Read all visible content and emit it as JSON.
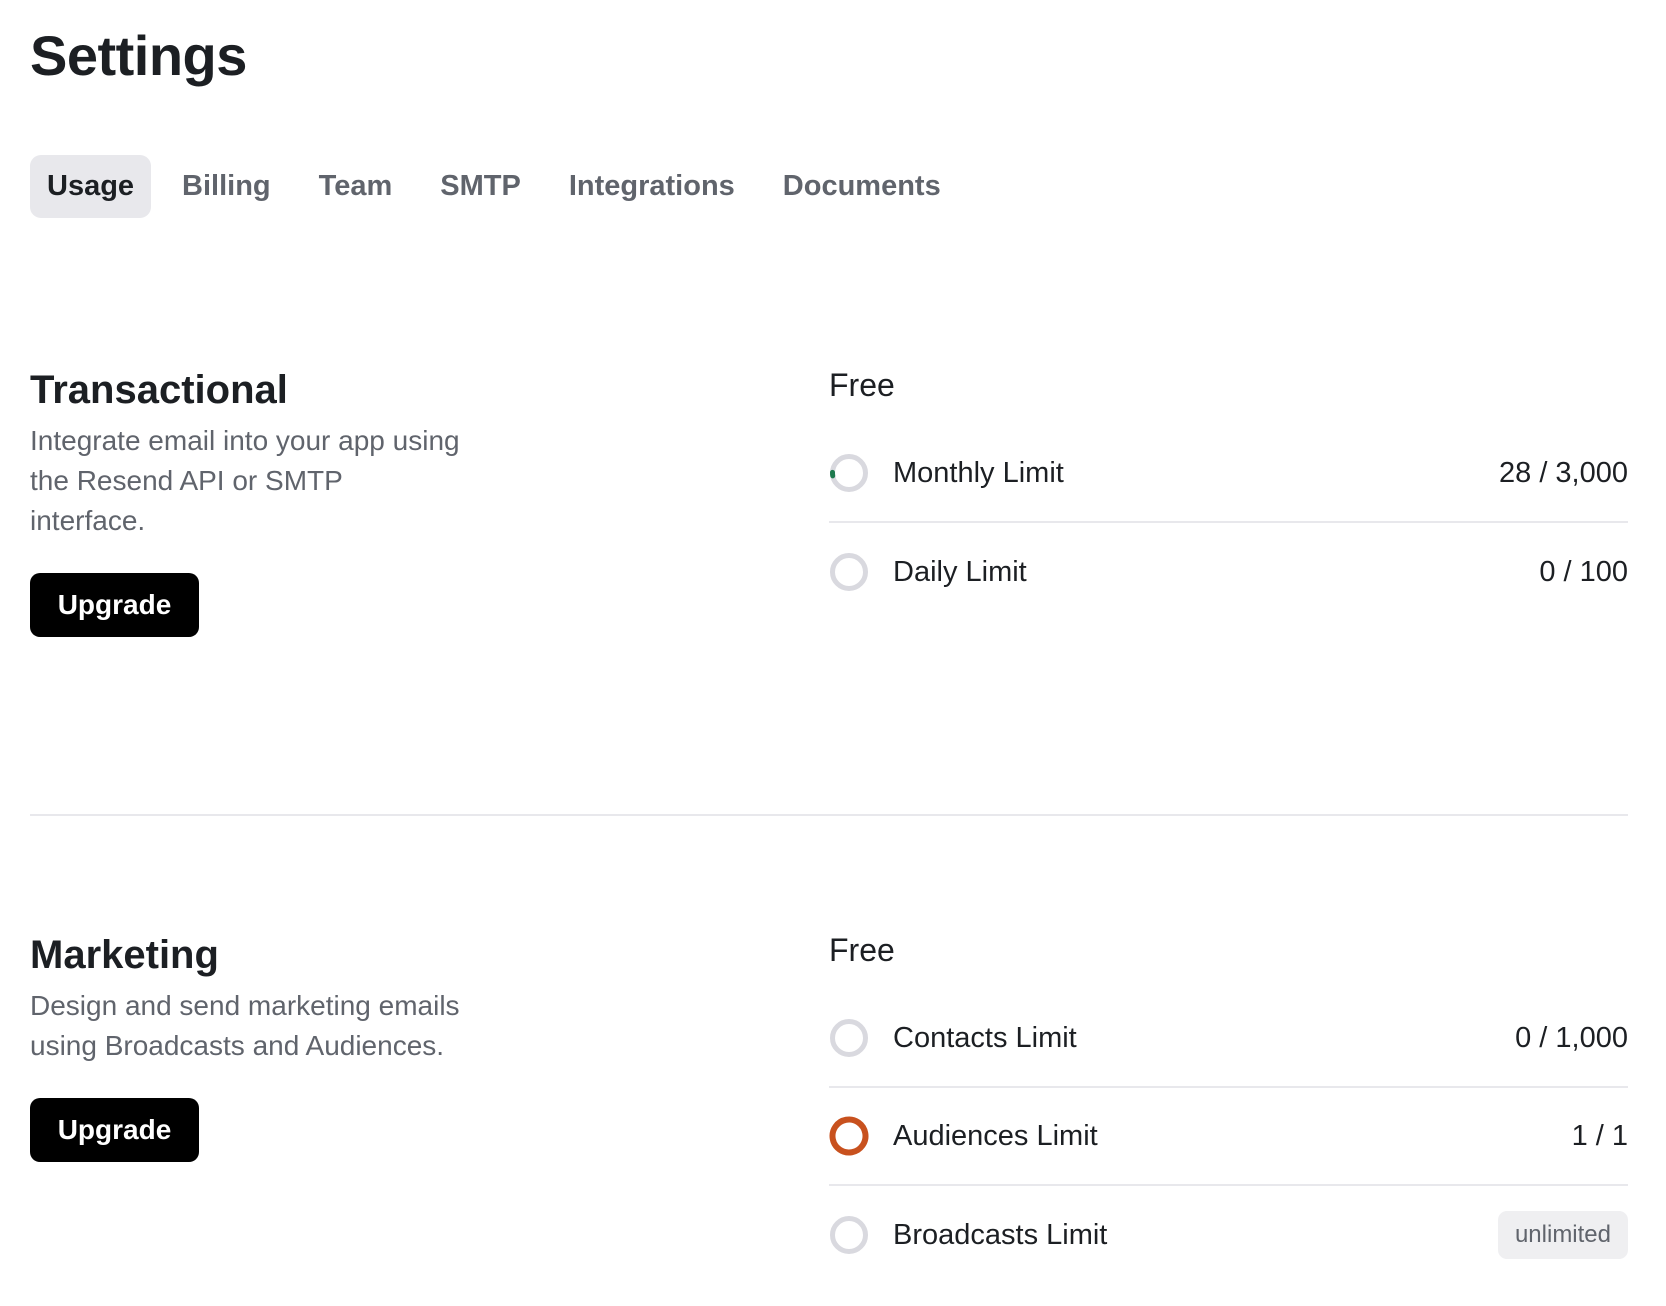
{
  "page": {
    "title": "Settings"
  },
  "tabs": [
    {
      "label": "Usage",
      "active": true
    },
    {
      "label": "Billing",
      "active": false
    },
    {
      "label": "Team",
      "active": false
    },
    {
      "label": "SMTP",
      "active": false
    },
    {
      "label": "Integrations",
      "active": false
    },
    {
      "label": "Documents",
      "active": false
    }
  ],
  "colors": {
    "ring_track": "#d9d9df",
    "usage_low": "#1e7a4e",
    "usage_full": "#c8511e",
    "primary_button": "#000000"
  },
  "sections": [
    {
      "heading": "Transactional",
      "description": "Integrate email into your app using the Resend API or SMTP interface.",
      "button_label": "Upgrade",
      "plan": "Free",
      "limits": [
        {
          "label": "Monthly Limit",
          "value": "28 / 3,000",
          "used": 28,
          "max": 3000,
          "badge": false
        },
        {
          "label": "Daily Limit",
          "value": "0 / 100",
          "used": 0,
          "max": 100,
          "badge": false
        }
      ]
    },
    {
      "heading": "Marketing",
      "description": "Design and send marketing emails using Broadcasts and Audiences.",
      "button_label": "Upgrade",
      "plan": "Free",
      "limits": [
        {
          "label": "Contacts Limit",
          "value": "0 / 1,000",
          "used": 0,
          "max": 1000,
          "badge": false
        },
        {
          "label": "Audiences Limit",
          "value": "1 / 1",
          "used": 1,
          "max": 1,
          "badge": false
        },
        {
          "label": "Broadcasts Limit",
          "value": "unlimited",
          "used": 0,
          "max": null,
          "badge": true
        }
      ]
    }
  ]
}
